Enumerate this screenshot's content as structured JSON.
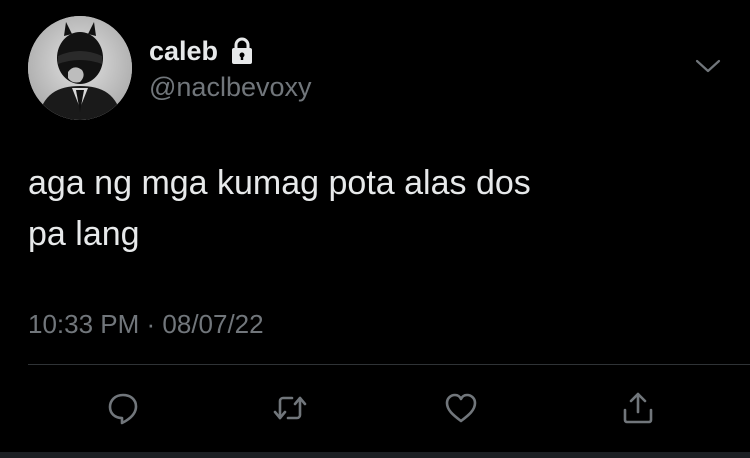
{
  "user": {
    "display_name": "caleb",
    "handle": "@naclbevoxy",
    "protected": true,
    "avatar_icon": "avatar-helmet-photo"
  },
  "tweet": {
    "text": "aga ng mga kumag pota alas dos\npa lang",
    "timestamp": "10:33 PM · 08/07/22"
  },
  "actions": [
    {
      "name": "reply",
      "icon": "reply-icon"
    },
    {
      "name": "retweet",
      "icon": "retweet-icon"
    },
    {
      "name": "like",
      "icon": "heart-icon"
    },
    {
      "name": "share",
      "icon": "share-icon"
    }
  ],
  "colors": {
    "background": "#000000",
    "primary_text": "#e7e9ea",
    "secondary_text": "#71767b",
    "divider": "#2f3336"
  }
}
